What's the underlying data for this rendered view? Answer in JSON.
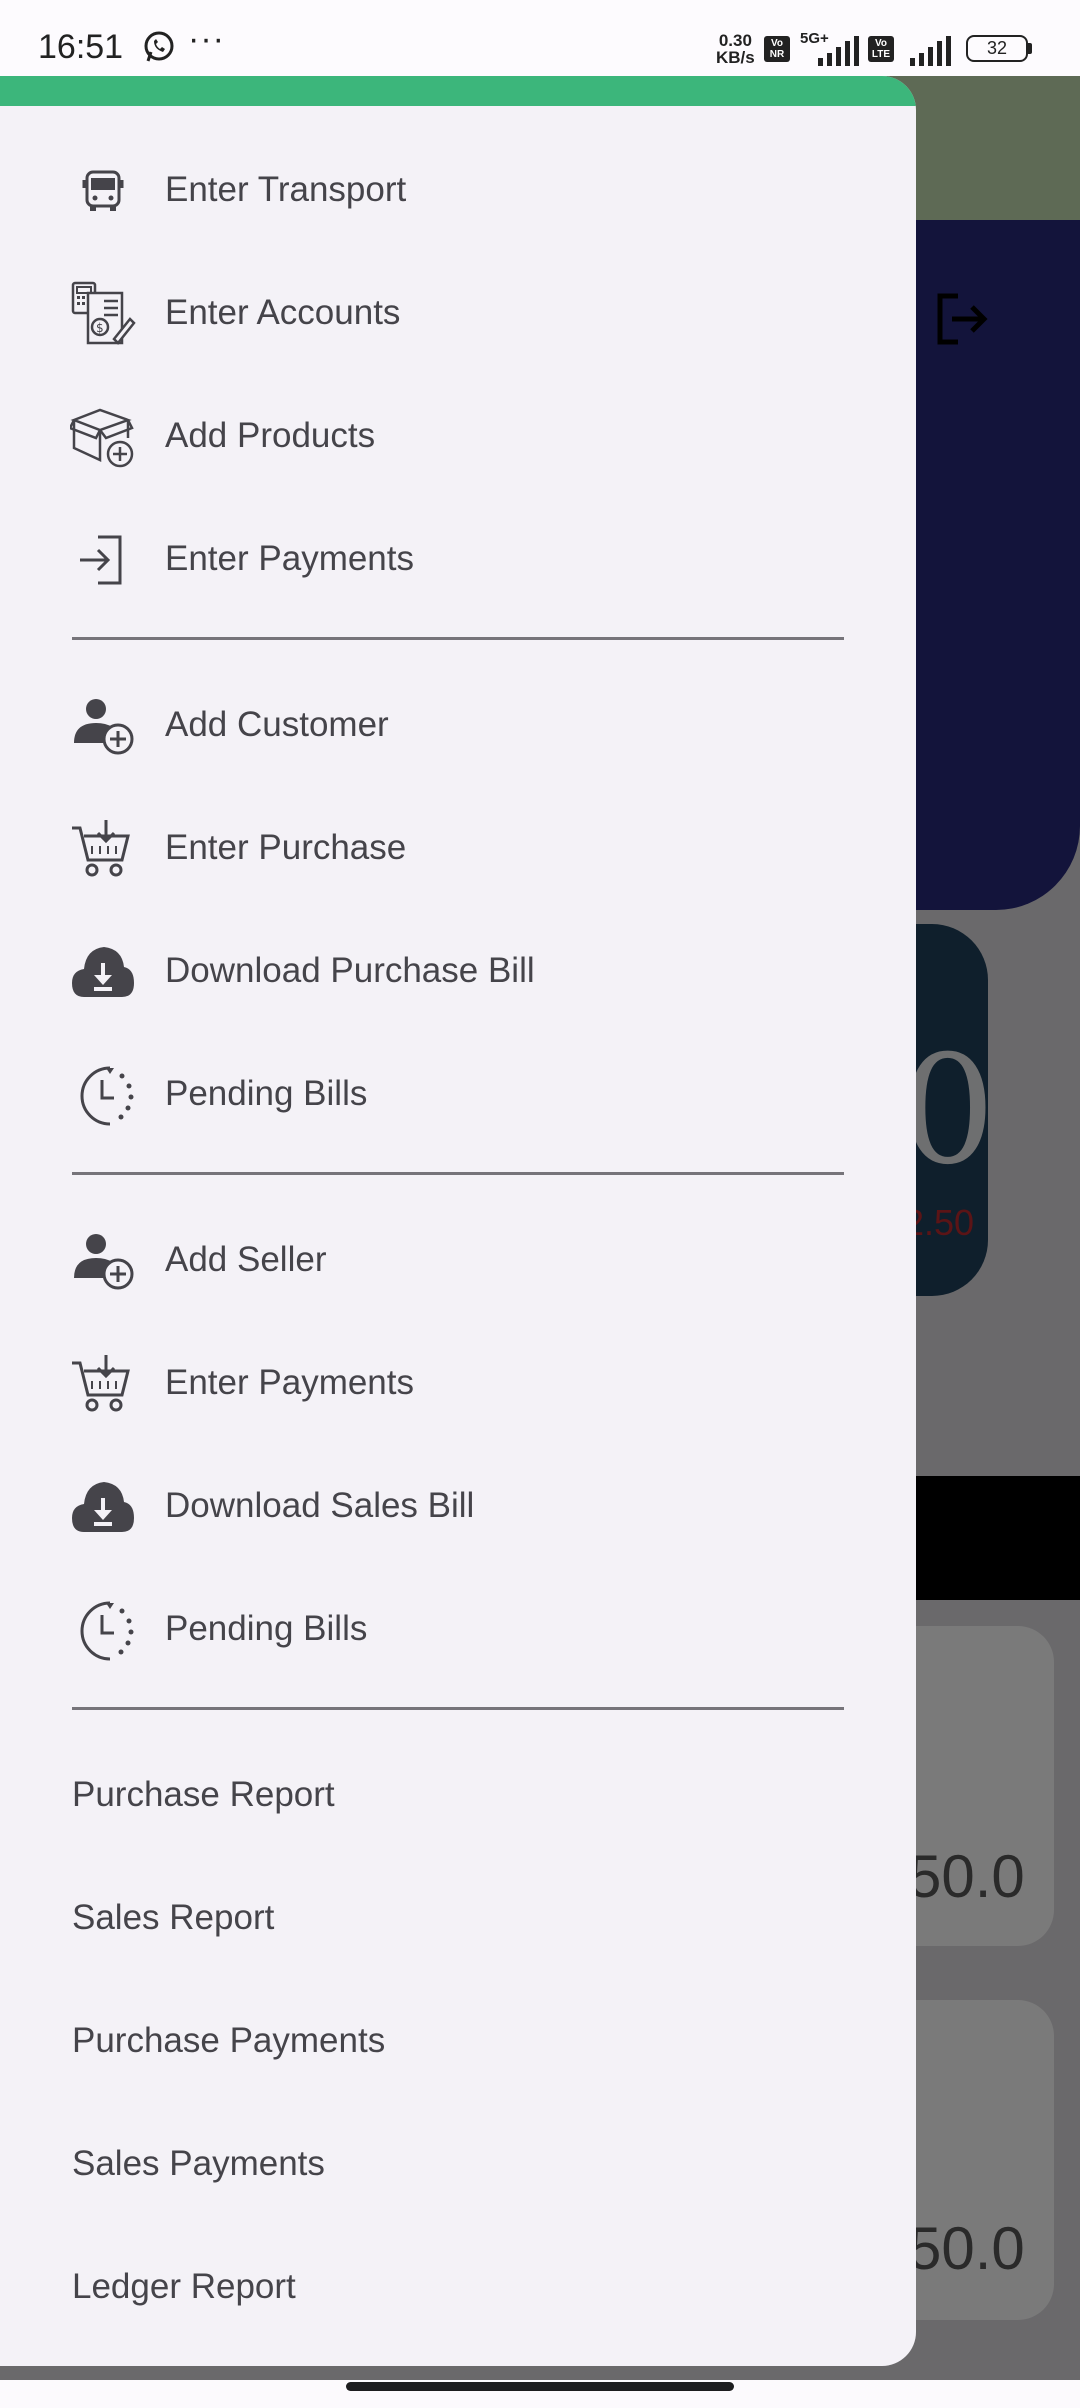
{
  "status_bar": {
    "time": "16:51",
    "dots": "···",
    "net_speed_value": "0.30",
    "net_speed_unit": "KB/s",
    "badge_vonr": "Vo NR",
    "network_5g": "5G+",
    "badge_volte": "Vo LTE",
    "battery": "32"
  },
  "background": {
    "big_value": "0",
    "red_value": "2.50",
    "card_value_1": "50.0",
    "card_value_2": "50.0"
  },
  "drawer": {
    "accent_color": "#3cb67b",
    "section_1": [
      {
        "label": "Enter Transport",
        "icon": "bus-icon"
      },
      {
        "label": "Enter Accounts",
        "icon": "accounts-icon"
      },
      {
        "label": "Add Products",
        "icon": "add-box-icon"
      },
      {
        "label": "Enter Payments",
        "icon": "login-icon"
      }
    ],
    "section_2": [
      {
        "label": "Add Customer",
        "icon": "add-user-icon"
      },
      {
        "label": "Enter Purchase",
        "icon": "cart-download-icon"
      },
      {
        "label": "Download Purchase Bill",
        "icon": "cloud-download-icon"
      },
      {
        "label": "Pending Bills",
        "icon": "clock-pending-icon"
      }
    ],
    "section_3": [
      {
        "label": "Add Seller",
        "icon": "add-user-icon"
      },
      {
        "label": "Enter Payments",
        "icon": "cart-download-icon"
      },
      {
        "label": "Download Sales Bill",
        "icon": "cloud-download-icon"
      },
      {
        "label": "Pending Bills",
        "icon": "clock-pending-icon"
      }
    ],
    "section_4": [
      {
        "label": "Purchase Report"
      },
      {
        "label": "Sales Report"
      },
      {
        "label": "Purchase Payments"
      },
      {
        "label": "Sales Payments"
      },
      {
        "label": "Ledger Report"
      }
    ]
  }
}
